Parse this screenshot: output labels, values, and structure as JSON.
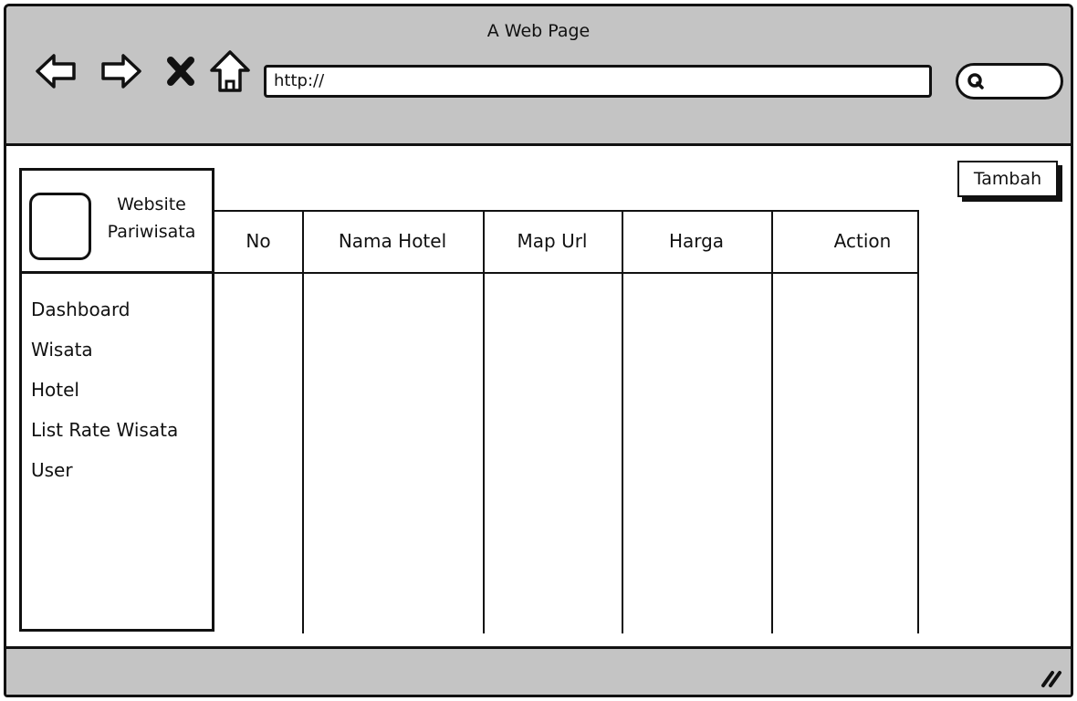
{
  "browser": {
    "title": "A Web Page",
    "url": "http://"
  },
  "sidebar": {
    "brand_line1": "Website",
    "brand_line2": "Pariwisata",
    "items": [
      {
        "label": "Dashboard"
      },
      {
        "label": "Wisata"
      },
      {
        "label": "Hotel"
      },
      {
        "label": "List Rate Wisata"
      },
      {
        "label": "User"
      }
    ]
  },
  "table": {
    "columns": [
      "No",
      "Nama Hotel",
      "Map Url",
      "Harga",
      "Action"
    ],
    "rows": []
  },
  "actions": {
    "add_label": "Tambah"
  }
}
